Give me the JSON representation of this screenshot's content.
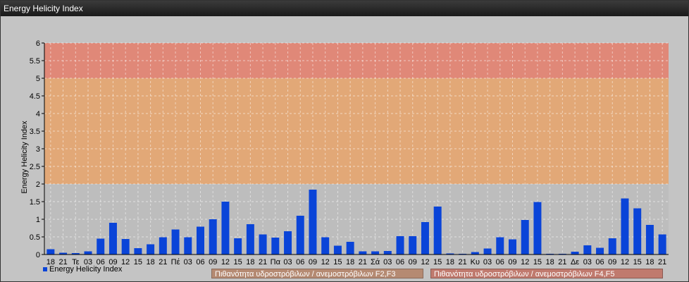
{
  "window": {
    "title": "Energy Helicity Index"
  },
  "colors": {
    "bar": "#0a44d8",
    "band_high": "#e08878",
    "band_mid": "#e2a877",
    "plot_bg": "#bdbdbd",
    "legend1": "#b58a72",
    "legend2": "#c07a6e"
  },
  "chart_data": {
    "type": "bar",
    "ylabel": "Energy Helicity Index",
    "ylim": [
      0,
      6
    ],
    "yticks": [
      "0",
      "0.5",
      "1",
      "1.5",
      "2",
      "2.5",
      "3",
      "3.5",
      "4",
      "4.5",
      "5",
      "5.5",
      "6"
    ],
    "bands": [
      {
        "from": 2,
        "to": 5,
        "label": "Πιθανότητα υδροστρόβιλων / ανεμοστρόβιλων F2,F3"
      },
      {
        "from": 5,
        "to": 6,
        "label": "Πιθανότητα υδροστρόβιλων / ανεμοστρόβιλων F4,F5"
      }
    ],
    "categories": [
      "18",
      "21",
      "Τε",
      "03",
      "06",
      "09",
      "12",
      "15",
      "18",
      "21",
      "Πέ",
      "03",
      "06",
      "09",
      "12",
      "15",
      "18",
      "21",
      "Πα",
      "03",
      "06",
      "09",
      "12",
      "15",
      "18",
      "21",
      "Σά",
      "03",
      "06",
      "09",
      "12",
      "15",
      "18",
      "21",
      "Κυ",
      "03",
      "06",
      "09",
      "12",
      "15",
      "18",
      "21",
      "Δε",
      "03",
      "06",
      "09",
      "12",
      "15",
      "18",
      "21"
    ],
    "series": [
      {
        "name": "Energy Helicity Index",
        "values": [
          0.15,
          0.05,
          0.04,
          0.09,
          0.45,
          0.9,
          0.44,
          0.18,
          0.29,
          0.49,
          0.71,
          0.49,
          0.79,
          1.0,
          1.5,
          0.46,
          0.86,
          0.57,
          0.48,
          0.66,
          1.1,
          1.84,
          0.49,
          0.25,
          0.36,
          0.09,
          0.09,
          0.1,
          0.52,
          0.52,
          0.92,
          1.36,
          0.03,
          0.02,
          0.07,
          0.17,
          0.49,
          0.43,
          0.98,
          1.49,
          0.02,
          0.02,
          0.08,
          0.26,
          0.19,
          0.46,
          1.59,
          1.31,
          0.84,
          0.57
        ]
      }
    ],
    "grid": true,
    "legend": "bottom"
  }
}
